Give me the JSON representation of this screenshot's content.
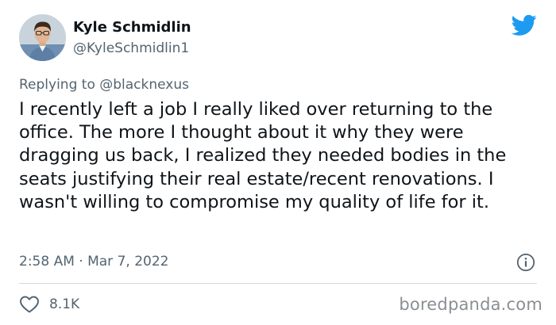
{
  "author": {
    "display_name": "Kyle Schmidlin",
    "handle": "@KyleSchmidlin1",
    "avatar_icon": "profile-photo"
  },
  "reply": {
    "prefix": "Replying to",
    "mention": "@blacknexus"
  },
  "tweet": {
    "text": "I recently left a job I really liked over returning to the office. The more I thought about it why they were dragging us back, I realized they needed bodies in the seats justifying their real estate/recent renovations. I wasn't willing to compromise my quality of life for it.",
    "timestamp": "2:58 AM · Mar 7, 2022",
    "like_count": "8.1K"
  },
  "icons": {
    "brand": "twitter-bird-icon",
    "info": "info-icon",
    "like": "heart-icon"
  },
  "colors": {
    "twitter_blue": "#1d9bf0",
    "secondary_text": "#536471",
    "primary_text": "#0f1419",
    "divider": "#cfd9de"
  },
  "watermark": "boredpanda.com"
}
